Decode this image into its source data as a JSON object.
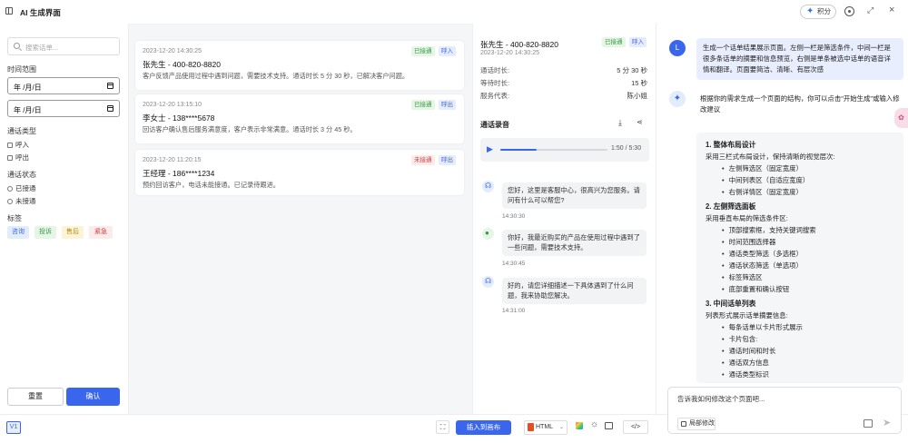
{
  "app": {
    "title": "AI 生成界面",
    "credits_label": "积分"
  },
  "filters": {
    "search_placeholder": "搜索话单...",
    "time_range_label": "时间范围",
    "date_placeholder_1": "年 /月/日",
    "date_placeholder_2": "年 /月/日",
    "call_type_label": "通话类型",
    "call_types": [
      "呼入",
      "呼出"
    ],
    "call_status_label": "通话状态",
    "call_statuses": [
      "已接通",
      "未接通"
    ],
    "tags_label": "标签",
    "tags": [
      {
        "label": "咨询",
        "bg": "#e3ecfb",
        "fg": "#3a66ee"
      },
      {
        "label": "投诉",
        "bg": "#e6f5e6",
        "fg": "#2f9a3f"
      },
      {
        "label": "售后",
        "bg": "#fdf4d8",
        "fg": "#b58a10"
      },
      {
        "label": "紧急",
        "bg": "#fdeaea",
        "fg": "#d04040"
      }
    ],
    "reset_label": "重置",
    "confirm_label": "确认"
  },
  "calls": [
    {
      "datetime": "2023-12-20 14:30:25",
      "name": "张先生 - 400-820-8820",
      "summary": "客户反馈产品使用过程中遇到问题，需要技术支持。通话时长 5 分 30 秒，已解决客户问题。",
      "status": "已接通",
      "direction": "呼入"
    },
    {
      "datetime": "2023-12-20 13:15:10",
      "name": "李女士 - 138****5678",
      "summary": "回访客户确认售后服务满意度，客户表示非常满意。通话时长 3 分 45 秒。",
      "status": "已接通",
      "direction": "呼出"
    },
    {
      "datetime": "2023-12-20 11:20:15",
      "name": "王经理 - 186****1234",
      "summary": "预约回访客户，电话未能接通。已记录待跟进。",
      "status": "未接通",
      "direction": "呼出"
    }
  ],
  "detail": {
    "name": "张先生 - 400-820-8820",
    "datetime": "2023-12-20 14:30:25",
    "status": "已接通",
    "direction": "呼入",
    "fields": [
      {
        "label": "通话时长:",
        "value": "5 分 30 秒"
      },
      {
        "label": "等待时长:",
        "value": "15 秒"
      },
      {
        "label": "服务代表:",
        "value": "陈小姐"
      }
    ],
    "recording_label": "通话录音",
    "audio_time": "1:50 / 5:30",
    "audio_progress": 0.34,
    "transcript": [
      {
        "speaker": "agent",
        "text": "您好，这里是客服中心，很高兴为您服务。请问有什么可以帮您?",
        "time": "14:30:30"
      },
      {
        "speaker": "customer",
        "text": "你好，我最近购买的产品在使用过程中遇到了一些问题，需要技术支持。",
        "time": "14:30:45"
      },
      {
        "speaker": "agent",
        "text": "好的，请您详细描述一下具体遇到了什么问题，我来协助您解决。",
        "time": "14:31:00"
      }
    ]
  },
  "chat": {
    "user_avatar": "L",
    "user_message": "生成一个话单结果展示页面。左侧一栏是筛选条件，中间一栏是很多条话单的摘要和信息预览，右侧是单条被选中话单的语音详情和翻译。页面要简洁、清晰、有层次感",
    "ai_intro": "根据你的需求生成一个页面的结构，你可以点击\"开始生成\"或输入修改建议",
    "sections": [
      {
        "title": "1. 整体布局设计",
        "text": "采用三栏式布局设计，保持清晰的视觉层次:",
        "items": [
          "左侧筛选区（固定宽度）",
          "中间列表区（自适应宽度）",
          "右侧详情区（固定宽度）"
        ]
      },
      {
        "title": "2. 左侧筛选面板",
        "text": "采用垂直布局的筛选条件区:",
        "items": [
          "顶部搜索框，支持关键词搜索",
          "时间范围选择器",
          "通话类型筛选（多选框）",
          "通话状态筛选（单选项）",
          "标签筛选区",
          "底部重置和确认按钮"
        ]
      },
      {
        "title": "3. 中间话单列表",
        "text": "列表形式展示话单摘要信息:",
        "items": [
          "每条话单以卡片形式展示",
          "卡片包含:",
          "通话时间和时长",
          "通话双方信息",
          "通话类型标识"
        ]
      }
    ],
    "input_placeholder": "告诉我如何修改这个页面吧...",
    "partial_edit_label": "局部修改"
  },
  "bottombar": {
    "version": "V1",
    "insert_label": "插入到画布",
    "format_label": "HTML"
  }
}
